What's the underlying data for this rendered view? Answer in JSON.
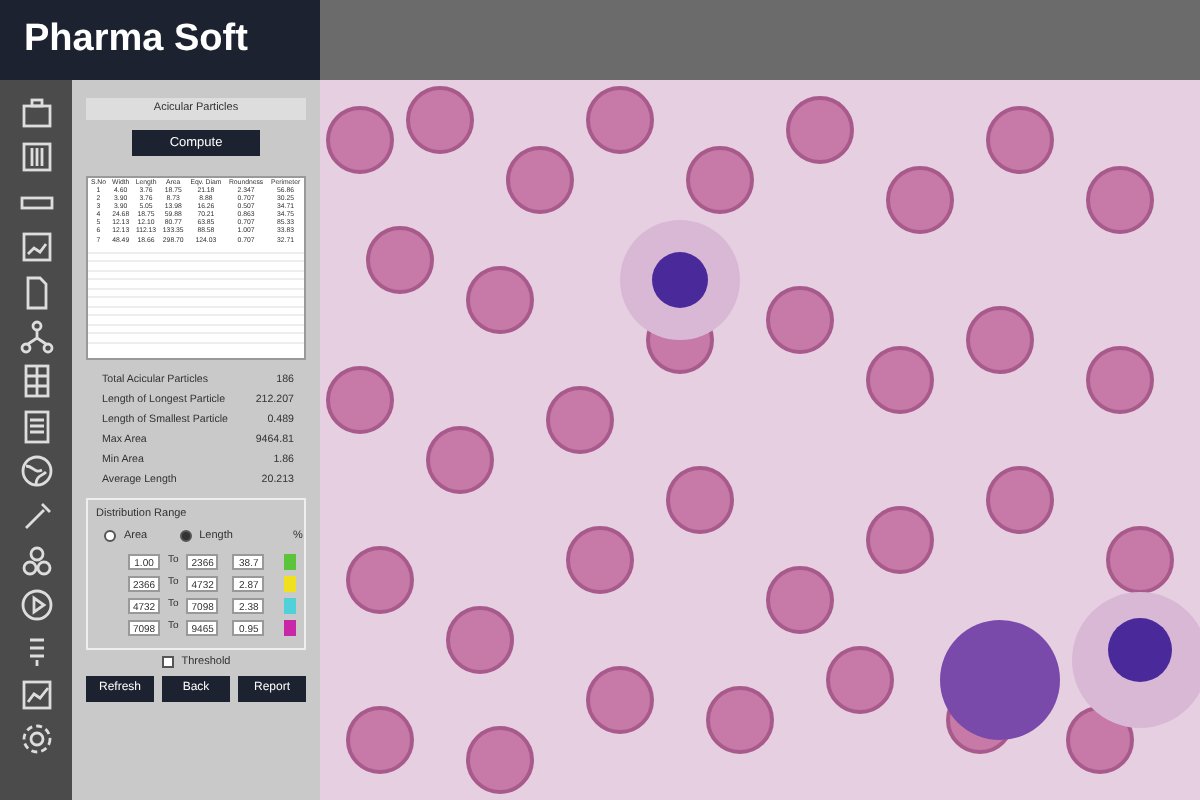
{
  "app": {
    "title": "Pharma Soft"
  },
  "panel": {
    "dropdown": "Acicular Particles",
    "compute_button": "Compute",
    "table": {
      "columns": [
        "S.No",
        "Width",
        "Length",
        "Area",
        "Eqv. Diam",
        "Roundness",
        "Perimeter"
      ],
      "rows": [
        [
          "1",
          "4.60",
          "3.76",
          "18.75",
          "21.18",
          "2.347",
          "56.86"
        ],
        [
          "2",
          "3.90",
          "3.76",
          "8.73",
          "8.88",
          "0.707",
          "30.25"
        ],
        [
          "3",
          "3.90",
          "5.05",
          "13.98",
          "16.26",
          "0.507",
          "34.71"
        ],
        [
          "4",
          "24.68",
          "18.75",
          "59.88",
          "70.21",
          "0.863",
          "34.75"
        ],
        [
          "5",
          "12.13",
          "12.10",
          "80.77",
          "63.85",
          "0.707",
          "85.33"
        ],
        [
          "6",
          "12.13",
          "112.13",
          "133.35",
          "88.58",
          "1.007",
          "33.83"
        ],
        [
          "7",
          "48.49",
          "18.66",
          "298.70",
          "124.03",
          "0.707",
          "32.71"
        ]
      ]
    },
    "stats": [
      {
        "label": "Total Acicular Particles",
        "value": "186"
      },
      {
        "label": "Length of Longest Particle",
        "value": "212.207"
      },
      {
        "label": "Length of Smallest Particle",
        "value": "0.489"
      },
      {
        "label": "Max Area",
        "value": "9464.81"
      },
      {
        "label": "Min Area",
        "value": "1.86"
      },
      {
        "label": "Average Length",
        "value": "20.213"
      }
    ],
    "distribution": {
      "title": "Distribution Range",
      "options": [
        {
          "label": "Area",
          "selected": false
        },
        {
          "label": "Length",
          "selected": true
        }
      ],
      "percent_header": "%",
      "ranges": [
        {
          "from": "1.00",
          "to_label": "To",
          "to": "2366",
          "percent": "38.7",
          "color": "#5cc43c"
        },
        {
          "from": "2366",
          "to_label": "To",
          "to": "4732",
          "percent": "2.87",
          "color": "#f0e020"
        },
        {
          "from": "4732",
          "to_label": "To",
          "to": "7098",
          "percent": "2.38",
          "color": "#50d0d8"
        },
        {
          "from": "7098",
          "to_label": "To",
          "to": "9465",
          "percent": "0.95",
          "color": "#c828a8"
        }
      ]
    },
    "threshold": {
      "label": "Threshold",
      "checked": false
    },
    "buttons": [
      "Refresh",
      "Back",
      "Report"
    ]
  }
}
